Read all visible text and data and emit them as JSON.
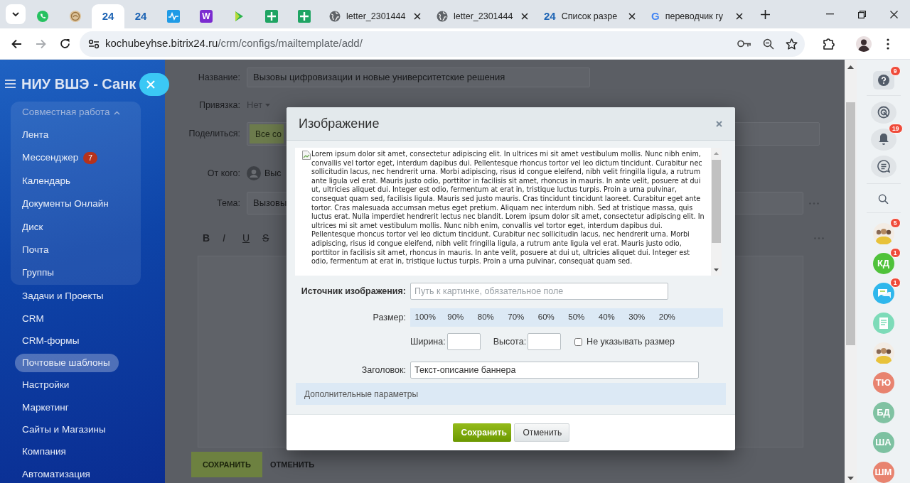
{
  "browser": {
    "tabs": [
      {
        "kind": "pinned",
        "selected": false
      },
      {
        "kind": "pinned",
        "selected": false
      },
      {
        "kind": "pinned",
        "logo": "24",
        "selected": true
      },
      {
        "kind": "pinned",
        "logo": "24",
        "selected": false
      },
      {
        "kind": "pinned",
        "selected": false
      },
      {
        "kind": "pinned",
        "logo": "W",
        "selected": false
      },
      {
        "kind": "pinned",
        "selected": false
      },
      {
        "kind": "pinned",
        "selected": false
      },
      {
        "kind": "pinned",
        "selected": false
      },
      {
        "kind": "full",
        "title": "letter_2301444",
        "selected": false
      },
      {
        "kind": "full",
        "title": "letter_2301444",
        "selected": false
      },
      {
        "kind": "full",
        "logo": "24",
        "title": "Список разре",
        "selected": false
      },
      {
        "kind": "full",
        "logo": "G",
        "title": "переводчик гу",
        "selected": false
      }
    ],
    "forward_disabled": true,
    "address": {
      "host": "kochubeyhse.bitrix24.ru",
      "path": "/crm/configs/mailtemplate/add/"
    }
  },
  "sidebar": {
    "title": "НИУ ВШЭ - Санк",
    "group": {
      "label": "Совместная работа",
      "expanded": true,
      "items": [
        {
          "label": "Лента",
          "selected": false
        },
        {
          "label": "Мессенджер",
          "counter": "7",
          "selected": false
        },
        {
          "label": "Календарь",
          "selected": false
        },
        {
          "label": "Документы Онлайн",
          "selected": false
        },
        {
          "label": "Диск",
          "selected": false
        },
        {
          "label": "Почта",
          "selected": false
        },
        {
          "label": "Группы",
          "selected": false
        }
      ]
    },
    "items": [
      {
        "label": "Задачи и Проекты",
        "selected": false
      },
      {
        "label": "CRM",
        "selected": false
      },
      {
        "label": "CRM-формы",
        "selected": false
      },
      {
        "label": "Почтовые шаблоны",
        "selected": true
      },
      {
        "label": "Настройки",
        "selected": false
      },
      {
        "label": "Маркетинг",
        "selected": false
      },
      {
        "label": "Сайты и Магазины",
        "selected": false
      },
      {
        "label": "Компания",
        "selected": false
      },
      {
        "label": "Автоматизация",
        "selected": false
      }
    ]
  },
  "template_form": {
    "name": {
      "label": "Название:",
      "value": "Вызовы цифровизации и новые университетские решения"
    },
    "binding": {
      "label": "Привязка:",
      "value": "Нет"
    },
    "share": {
      "label": "Поделиться:",
      "button": "Все со"
    },
    "sender": {
      "label": "От кого:",
      "value": "Выс"
    },
    "subject": {
      "label": "Тема:",
      "value": "Вызовы"
    },
    "format_buttons": [
      {
        "kind": "bold",
        "label": "B"
      },
      {
        "kind": "italic",
        "label": "I"
      },
      {
        "kind": "underline",
        "label": "U"
      },
      {
        "kind": "strike",
        "label": "S"
      }
    ],
    "save": "СОХРАНИТЬ",
    "cancel": "ОТМЕНИТЬ"
  },
  "dialog": {
    "title": "Изображение",
    "preview_text": "Lorem ipsum dolor sit amet, consectetur adipiscing elit. In ultrices mi sit amet vestibulum mollis. Nunc nibh enim, convallis vel tortor eget, interdum dapibus dui. Pellentesque rhoncus tortor vel leo dictum tincidunt. Curabitur nec sollicitudin lacus, nec hendrerit urna. Morbi adipiscing, risus id congue eleifend, nibh velit fringilla ligula, a rutrum ante ligula vel erat. Mauris justo odio, porttitor in facilisis sit amet, rhoncus in mauris. In ante velit, posuere at dui ut, ultricies aliquet dui. Integer est odio, fermentum at erat in, tristique luctus turpis. Proin a urna pulvinar, consequat quam sed, facilisis ligula. Mauris sed justo mauris. Cras tincidunt tincidunt laoreet. Curabitur eget ante tortor. Cras malesuada accumsan metus eget pretium. Aliquam nec interdum nibh. Sed at tristique massa, quis luctus erat. Nulla imperdiet hendrerit lectus nec blandit. Lorem ipsum dolor sit amet, consectetur adipiscing elit. In ultrices mi sit amet vestibulum mollis. Nunc nibh enim, convallis vel tortor eget, interdum dapibus dui. Pellentesque rhoncus tortor vel leo dictum tincidunt. Curabitur nec sollicitudin lacus, nec hendrerit urna. Morbi adipiscing, risus id congue eleifend, nibh velit fringilla ligula, a rutrum ante ligula vel erat. Mauris justo odio, porttitor in facilisis sit amet, rhoncus in mauris. In ante velit, posuere at dui ut, ultricies aliquet dui. Integer est odio, fermentum at erat in, tristique luctus turpis. Proin a urna pulvinar, consequat quam sed.",
    "source": {
      "label": "Источник изображения:",
      "placeholder": "Путь к картинке, обязательное поле"
    },
    "size": {
      "label": "Размер:",
      "options": [
        "100%",
        "90%",
        "80%",
        "70%",
        "60%",
        "50%",
        "40%",
        "30%",
        "20%"
      ]
    },
    "width_label": "Ширина:",
    "height_label": "Высота:",
    "no_size": {
      "label": "Не указывать размер",
      "checked": false
    },
    "caption": {
      "label": "Заголовок:",
      "value": "Текст-описание баннера"
    },
    "advanced": "Дополнительные параметры",
    "buttons": [
      {
        "kind": "primary",
        "label": "Сохранить"
      },
      {
        "kind": "secondary",
        "label": "Отменить"
      }
    ]
  },
  "right_panel": {
    "help_counter": "9",
    "notifications_counter": "19",
    "contacts": [
      {
        "kind": "photo",
        "counter": "5"
      },
      {
        "kind": "initials",
        "text": "КД",
        "color": "#4fc23a",
        "counter": "1"
      },
      {
        "kind": "app",
        "counter": "1"
      },
      {
        "kind": "app"
      },
      {
        "kind": "photo"
      },
      {
        "kind": "initials",
        "text": "ТЮ",
        "color": "#e8836f"
      },
      {
        "kind": "initials",
        "text": "БД",
        "color": "#80c2a2"
      },
      {
        "kind": "initials",
        "text": "ША",
        "color": "#7dc1a1"
      },
      {
        "kind": "initials",
        "text": "ШМ",
        "color": "#e8836f"
      }
    ]
  }
}
